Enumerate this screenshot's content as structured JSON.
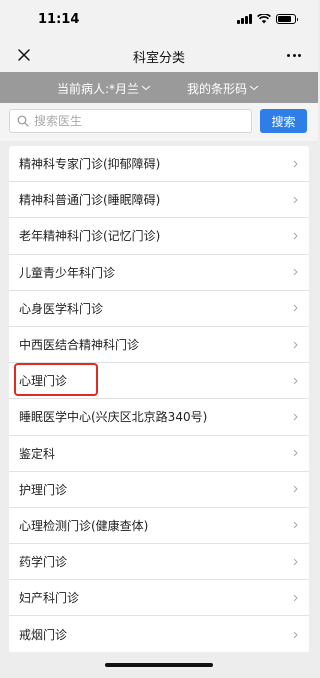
{
  "status_bar": {
    "time": "11:14",
    "battery_level": 0.8
  },
  "nav": {
    "title": "科室分类",
    "close_icon": "close-icon",
    "more_icon": "more-icon"
  },
  "info_bar": {
    "patient_label": "当前病人:*月兰",
    "barcode_label": "我的条形码"
  },
  "search": {
    "placeholder": "搜索医生",
    "button_label": "搜索"
  },
  "departments": [
    {
      "label": "精神科专家门诊(抑郁障碍)"
    },
    {
      "label": "精神科普通门诊(睡眠障碍)"
    },
    {
      "label": "老年精神科门诊(记忆门诊)"
    },
    {
      "label": "儿童青少年科门诊"
    },
    {
      "label": "心身医学科门诊"
    },
    {
      "label": "中西医结合精神科门诊"
    },
    {
      "label": "心理门诊"
    },
    {
      "label": "睡眠医学中心(兴庆区北京路340号)"
    },
    {
      "label": "鉴定科"
    },
    {
      "label": "护理门诊"
    },
    {
      "label": "心理检测门诊(健康查体)"
    },
    {
      "label": "药学门诊"
    },
    {
      "label": "妇产科门诊"
    },
    {
      "label": "戒烟门诊"
    }
  ],
  "highlighted_department_index": 6,
  "colors": {
    "accent": "#2f7ee8",
    "highlight": "#e02b22",
    "info_bar": "#9a9a9a"
  }
}
